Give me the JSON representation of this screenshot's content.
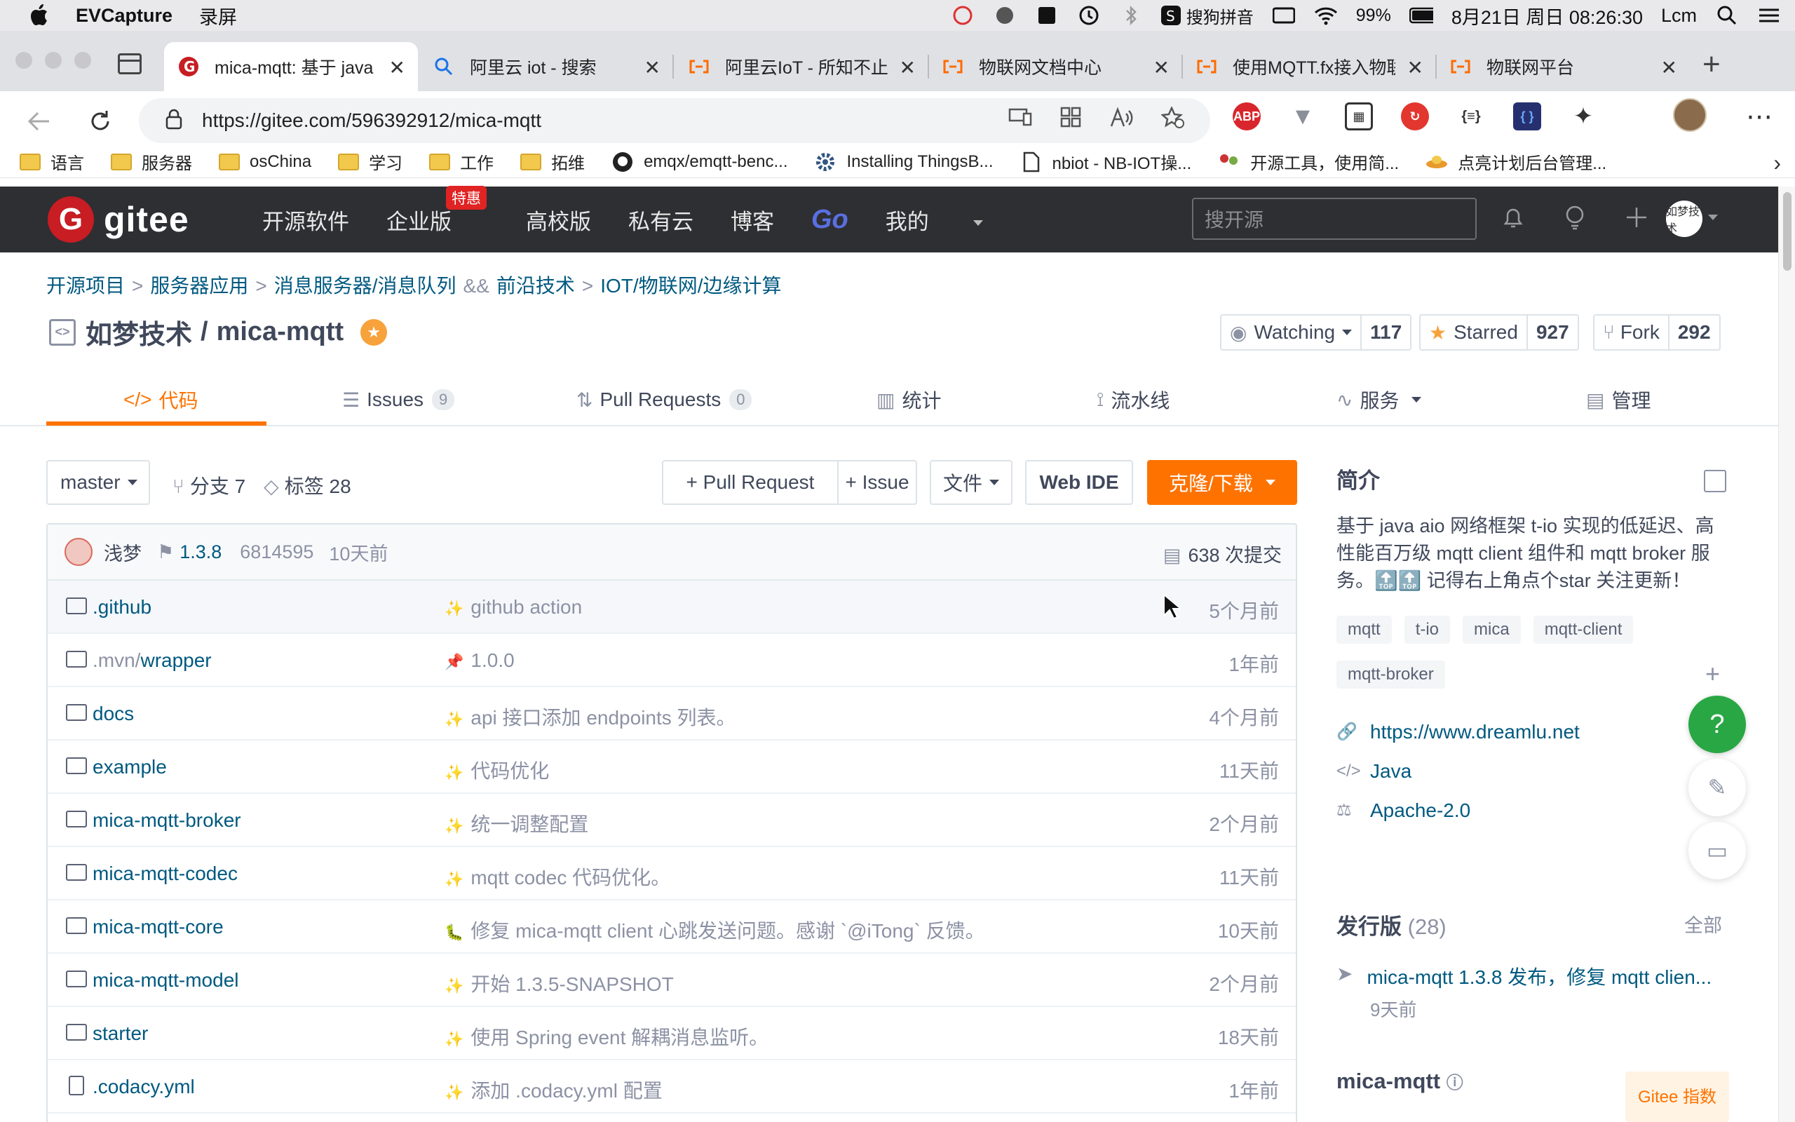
{
  "menubar": {
    "app_name": "EVCapture",
    "menu_item": "录屏",
    "ime": "搜狗拼音",
    "battery": "99%",
    "datetime": "8月21日 周日 08:26:30",
    "user": "Lcm"
  },
  "tabs": [
    {
      "title": "mica-mqtt: 基于 java aio",
      "favicon": "gitee-icon"
    },
    {
      "title": "阿里云 iot - 搜索",
      "favicon": "search-icon"
    },
    {
      "title": "阿里云IoT - 所知不止",
      "favicon": "aliyun-icon"
    },
    {
      "title": "物联网文档中心",
      "favicon": "aliyun-icon"
    },
    {
      "title": "使用MQTT.fx接入物联",
      "favicon": "aliyun-icon"
    },
    {
      "title": "物联网平台",
      "favicon": "aliyun-icon"
    }
  ],
  "address": {
    "url": "https://gitee.com/596392912/mica-mqtt"
  },
  "extensions": [
    "ABP",
    "V",
    "QR",
    "R",
    "{≡}",
    "{ }",
    "puzzle"
  ],
  "bookmarks": [
    {
      "label": "语言",
      "icon": "folder-icon"
    },
    {
      "label": "服务器",
      "icon": "folder-icon"
    },
    {
      "label": "osChina",
      "icon": "folder-icon"
    },
    {
      "label": "学习",
      "icon": "folder-icon"
    },
    {
      "label": "工作",
      "icon": "folder-icon"
    },
    {
      "label": "拓维",
      "icon": "folder-icon"
    },
    {
      "label": "emqx/emqtt-benc...",
      "icon": "github-icon"
    },
    {
      "label": "Installing ThingsB...",
      "icon": "gear-icon"
    },
    {
      "label": "nbiot - NB-IOT操...",
      "icon": "page-icon"
    },
    {
      "label": "开源工具，使用简...",
      "icon": "people-icon"
    },
    {
      "label": "点亮计划后台管理...",
      "icon": "ufo-icon"
    }
  ],
  "gitee": {
    "logo_text": "gitee",
    "nav": [
      "开源软件",
      "企业版",
      "高校版",
      "私有云",
      "博客",
      "Go",
      "我的"
    ],
    "enterprise_badge": "特惠",
    "search_placeholder": "搜开源",
    "avatar_text": "如梦技术"
  },
  "breadcrumb": {
    "items": [
      "开源项目",
      "服务器应用",
      "消息服务器/消息队列",
      "前沿技术",
      "IOT/物联网/边缘计算"
    ],
    "separators": [
      ">",
      ">",
      "&&",
      ">"
    ]
  },
  "repo": {
    "owner": "如梦技术",
    "slash": "/",
    "name": "mica-mqtt",
    "watch_label": "Watching",
    "watch_count": "117",
    "star_label": "Starred",
    "star_count": "927",
    "fork_label": "Fork",
    "fork_count": "292"
  },
  "repo_tabs": [
    {
      "label": "代码",
      "count": ""
    },
    {
      "label": "Issues",
      "count": "9"
    },
    {
      "label": "Pull Requests",
      "count": "0"
    },
    {
      "label": "统计",
      "count": ""
    },
    {
      "label": "流水线",
      "count": ""
    },
    {
      "label": "服务",
      "count": ""
    },
    {
      "label": "管理",
      "count": ""
    }
  ],
  "toolbar": {
    "branch": "master",
    "branches": "分支 7",
    "tags": "标签 28",
    "pull_request": "+ Pull Request",
    "issue": "+ Issue",
    "file_menu": "文件",
    "web_ide": "Web IDE",
    "clone": "克隆/下载"
  },
  "last_commit": {
    "author": "浅梦",
    "version": "1.3.8",
    "sha": "6814595",
    "time": "10天前",
    "commits": "638 次提交"
  },
  "files": [
    {
      "name": ".github",
      "prefix": "",
      "type": "folder",
      "message": "github action",
      "time": "5个月前"
    },
    {
      "name": "wrapper",
      "prefix": ".mvn/",
      "type": "folder",
      "message": "1.0.0",
      "time": "1年前"
    },
    {
      "name": "docs",
      "prefix": "",
      "type": "folder",
      "message": "api 接口添加 endpoints 列表。",
      "time": "4个月前"
    },
    {
      "name": "example",
      "prefix": "",
      "type": "folder",
      "message": "代码优化",
      "time": "11天前"
    },
    {
      "name": "mica-mqtt-broker",
      "prefix": "",
      "type": "folder",
      "message": "统一调整配置",
      "time": "2个月前"
    },
    {
      "name": "mica-mqtt-codec",
      "prefix": "",
      "type": "folder",
      "message": "mqtt codec 代码优化。",
      "time": "11天前"
    },
    {
      "name": "mica-mqtt-core",
      "prefix": "",
      "type": "folder",
      "message": "修复 mica-mqtt client 心跳发送问题。感谢 `@iTong` 反馈。",
      "time": "10天前"
    },
    {
      "name": "mica-mqtt-model",
      "prefix": "",
      "type": "folder",
      "message": "开始 1.3.5-SNAPSHOT",
      "time": "2个月前"
    },
    {
      "name": "starter",
      "prefix": "",
      "type": "folder",
      "message": "使用 Spring event 解耦消息监听。",
      "time": "18天前"
    },
    {
      "name": ".codacy.yml",
      "prefix": "",
      "type": "file",
      "message": "添加 .codacy.yml 配置",
      "time": "1年前"
    }
  ],
  "sidebar": {
    "intro_title": "简介",
    "description": "基于 java aio 网络框架 t-io 实现的低延迟、高性能百万级 mqtt client 组件和 mqtt broker 服务。🔝🔝 记得右上角点个star 关注更新！",
    "tags": [
      "mqtt",
      "t-io",
      "mica",
      "mqtt-client",
      "mqtt-broker"
    ],
    "website": "https://www.dreamlu.net",
    "language": "Java",
    "license": "Apache-2.0",
    "releases_title": "发行版",
    "releases_count": "(28)",
    "releases_all": "全部",
    "latest_release": "mica-mqtt 1.3.8 发布，修复 mqtt clien...",
    "latest_release_date": "9天前",
    "index_title": "mica-mqtt",
    "gitee_index": "Gitee 指数"
  }
}
